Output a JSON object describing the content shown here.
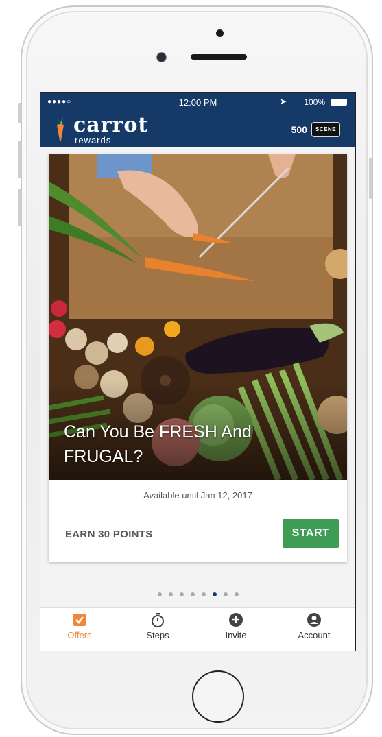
{
  "status_bar": {
    "signal": "●●●●○",
    "time": "12:00 PM",
    "battery": "100%"
  },
  "app_bar": {
    "brand": "carrot",
    "brand_sub": "rewards",
    "points": "500",
    "scene_badge": "SCENE"
  },
  "offer_card": {
    "title": "Can You Be FRESH And FRUGAL?",
    "availability": "Available until Jan 12, 2017",
    "earn_label": "EARN 30 POINTS",
    "start_label": "START"
  },
  "pagination": {
    "total": 8,
    "active_index": 5
  },
  "tabs": [
    {
      "label": "Offers",
      "icon": "check-box-icon",
      "active": true
    },
    {
      "label": "Steps",
      "icon": "stopwatch-icon",
      "active": false
    },
    {
      "label": "Invite",
      "icon": "plus-circle-icon",
      "active": false
    },
    {
      "label": "Account",
      "icon": "account-circle-icon",
      "active": false
    }
  ],
  "colors": {
    "header": "#163a68",
    "accent": "#f0873a",
    "start_button": "#3e9c55"
  }
}
